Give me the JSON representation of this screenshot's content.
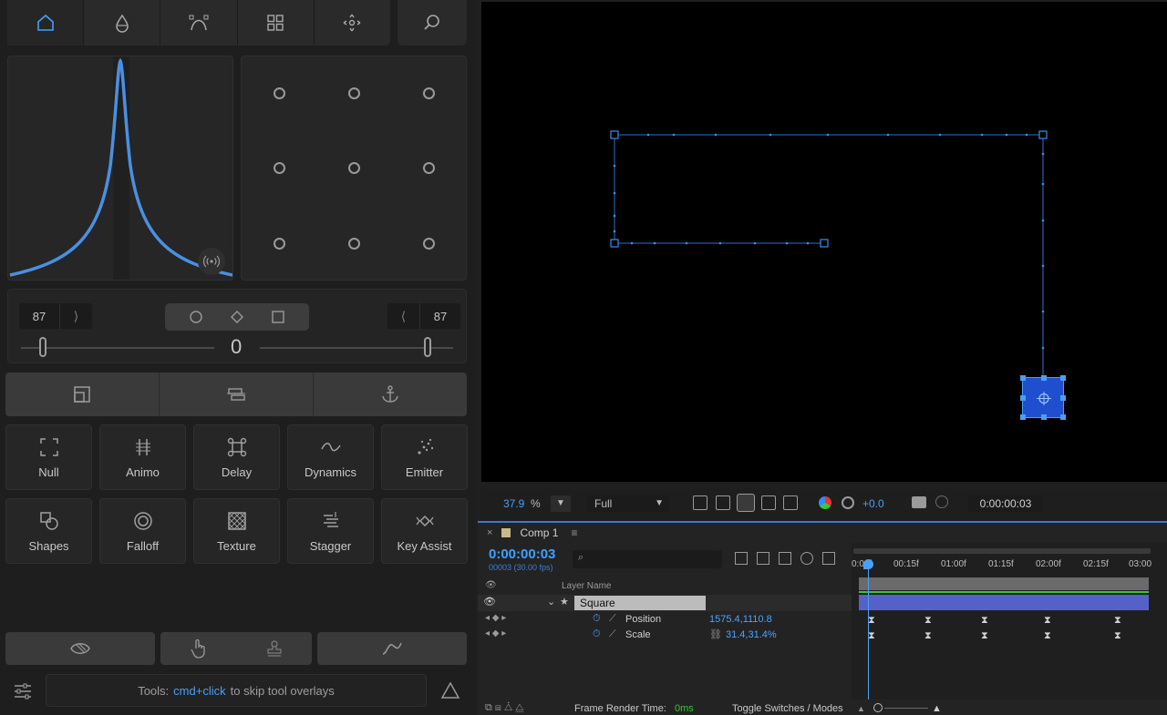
{
  "sliders": {
    "left_value": "87",
    "right_value": "87",
    "left_pos": "0",
    "mid_pos": "0",
    "right_pos": "0"
  },
  "tools": [
    {
      "label": "Null",
      "icon": "null-icon"
    },
    {
      "label": "Animo",
      "icon": "animo-icon"
    },
    {
      "label": "Delay",
      "icon": "delay-icon"
    },
    {
      "label": "Dynamics",
      "icon": "dynamics-icon"
    },
    {
      "label": "Emitter",
      "icon": "emitter-icon"
    },
    {
      "label": "Shapes",
      "icon": "shapes-icon"
    },
    {
      "label": "Falloff",
      "icon": "falloff-icon"
    },
    {
      "label": "Texture",
      "icon": "texture-icon"
    },
    {
      "label": "Stagger",
      "icon": "stagger-icon"
    },
    {
      "label": "Key Assist",
      "icon": "key-assist-icon"
    }
  ],
  "status": {
    "prefix": "Tools:",
    "accent": "cmd+click",
    "suffix": "to skip tool overlays"
  },
  "viewer_bar": {
    "zoom": "37.9",
    "zoom_unit": "%",
    "resolution": "Full",
    "exposure": "+0.0",
    "timecode": "0:00:00:03"
  },
  "timeline": {
    "comp_name": "Comp 1",
    "current_time": "0:00:00:03",
    "frame_info": "00003 (30.00 fps)",
    "ruler": [
      "0:00f",
      "00:15f",
      "01:00f",
      "01:15f",
      "02:00f",
      "02:15f",
      "03:00"
    ],
    "column_header": "Layer Name",
    "layer_name": "Square",
    "properties": [
      {
        "name": "Position",
        "value": "1575.4,1110.8"
      },
      {
        "name": "Scale",
        "value": "31.4,31.4%"
      }
    ],
    "footer_label": "Frame Render Time:",
    "footer_value": "0ms",
    "footer_toggle": "Toggle Switches / Modes"
  },
  "colors": {
    "accent": "#3a8ee8",
    "curve": "#4a90e2",
    "selection": "#1f5fd6",
    "green": "#39c639"
  }
}
